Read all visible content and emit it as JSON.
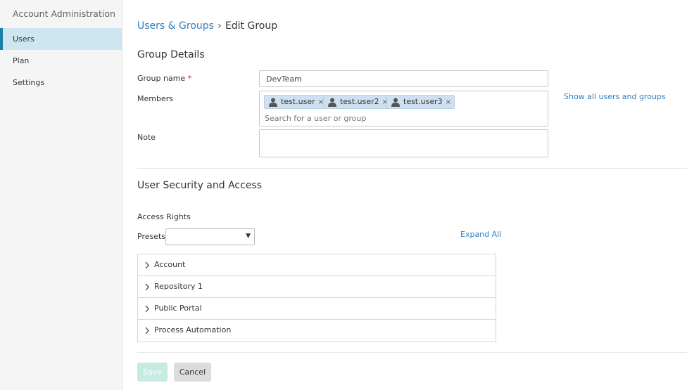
{
  "sidebar": {
    "title": "Account Administration",
    "items": [
      {
        "label": "Users"
      },
      {
        "label": "Plan"
      },
      {
        "label": "Settings"
      }
    ]
  },
  "breadcrumb": {
    "parent": "Users & Groups",
    "separator": "›",
    "current": "Edit Group"
  },
  "group_details": {
    "title": "Group Details",
    "group_name_label": "Group name",
    "required_mark": "*",
    "group_name_value": "DevTeam",
    "members_label": "Members",
    "members": [
      {
        "name": "test.user",
        "remove": "×"
      },
      {
        "name": "test.user2",
        "remove": "×"
      },
      {
        "name": "test.user3",
        "remove": "×"
      }
    ],
    "members_search_placeholder": "Search for a user or group",
    "show_all_link": "Show all users and groups",
    "note_label": "Note",
    "note_value": ""
  },
  "security": {
    "title": "User Security and Access",
    "access_rights_label": "Access Rights",
    "presets_label": "Presets",
    "presets_value": "",
    "presets_arrow": "▼",
    "expand_all": "Expand All",
    "sections": [
      {
        "label": "Account"
      },
      {
        "label": "Repository 1"
      },
      {
        "label": "Public Portal"
      },
      {
        "label": "Process Automation"
      }
    ]
  },
  "actions": {
    "save_label": "Save",
    "cancel_label": "Cancel"
  },
  "colors": {
    "link": "#2f7fc1",
    "active_nav_bg": "#cde6f0",
    "active_nav_accent": "#1a7fa6",
    "chip_bg": "#cfe1f0",
    "save_disabled_bg": "#c5ebe2"
  }
}
